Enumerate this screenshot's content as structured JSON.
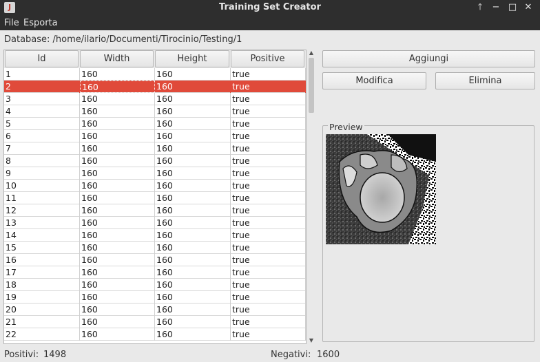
{
  "window": {
    "title": "Training Set Creator",
    "icon_glyph": "J"
  },
  "window_controls": {
    "up": "🡑",
    "minimize": "−",
    "maximize": "□",
    "close": "✕"
  },
  "menu": {
    "file": "File",
    "esporta": "Esporta"
  },
  "database_label": "Database: /home/ilario/Documenti/Tirocinio/Testing/1",
  "table": {
    "columns": [
      "Id",
      "Width",
      "Height",
      "Positive"
    ],
    "selected_row": 2,
    "rows": [
      [
        "1",
        "160",
        "160",
        "true"
      ],
      [
        "2",
        "160",
        "160",
        "true"
      ],
      [
        "3",
        "160",
        "160",
        "true"
      ],
      [
        "4",
        "160",
        "160",
        "true"
      ],
      [
        "5",
        "160",
        "160",
        "true"
      ],
      [
        "6",
        "160",
        "160",
        "true"
      ],
      [
        "7",
        "160",
        "160",
        "true"
      ],
      [
        "8",
        "160",
        "160",
        "true"
      ],
      [
        "9",
        "160",
        "160",
        "true"
      ],
      [
        "10",
        "160",
        "160",
        "true"
      ],
      [
        "11",
        "160",
        "160",
        "true"
      ],
      [
        "12",
        "160",
        "160",
        "true"
      ],
      [
        "13",
        "160",
        "160",
        "true"
      ],
      [
        "14",
        "160",
        "160",
        "true"
      ],
      [
        "15",
        "160",
        "160",
        "true"
      ],
      [
        "16",
        "160",
        "160",
        "true"
      ],
      [
        "17",
        "160",
        "160",
        "true"
      ],
      [
        "18",
        "160",
        "160",
        "true"
      ],
      [
        "19",
        "160",
        "160",
        "true"
      ],
      [
        "20",
        "160",
        "160",
        "true"
      ],
      [
        "21",
        "160",
        "160",
        "true"
      ],
      [
        "22",
        "160",
        "160",
        "true"
      ]
    ]
  },
  "buttons": {
    "aggiungi": "Aggiungi",
    "modifica": "Modifica",
    "elimina": "Elimina"
  },
  "preview": {
    "label": "Preview"
  },
  "status": {
    "positivi_label": "Positivi:",
    "positivi_value": "1498",
    "negativi_label": "Negativi:",
    "negativi_value": "1600"
  },
  "colors": {
    "selection": "#e04a3a",
    "titlebar": "#2e2e2e"
  }
}
